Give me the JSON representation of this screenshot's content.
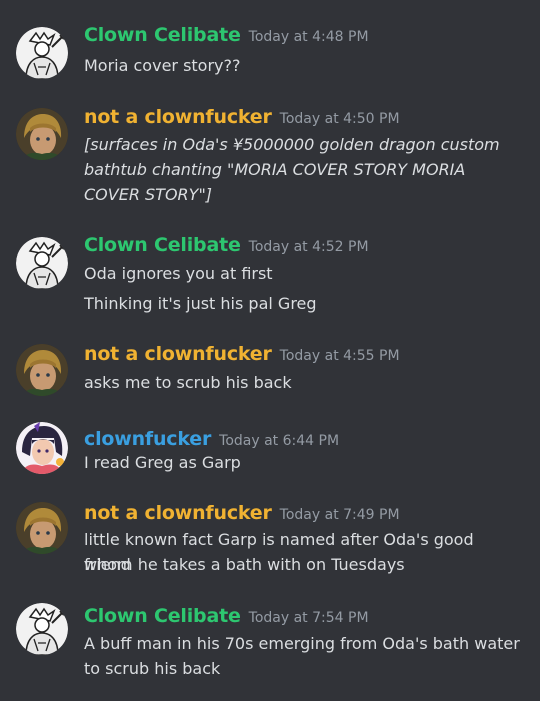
{
  "colors": {
    "background": "#313338",
    "clown_celibate": "#2dc770",
    "not_a_clownfucker": "#f0b232",
    "clownfucker": "#3a9fe0",
    "timestamp": "#949ba4",
    "text": "#dbdee1"
  },
  "messages": [
    {
      "author": "Clown Celibate",
      "timestamp": "Today at 4:48 PM",
      "lines": [
        "Moria cover story??"
      ]
    },
    {
      "author": "not a clownfucker",
      "timestamp": "Today at 4:50 PM",
      "lines": [
        "[surfaces in Oda's ¥5000000 golden dragon custom",
        "bathtub chanting \"MORIA COVER STORY MORIA",
        "COVER STORY\"]"
      ]
    },
    {
      "author": "Clown Celibate",
      "timestamp": "Today at 4:52 PM",
      "lines": [
        "Oda ignores you at first",
        "Thinking it's just his pal Greg"
      ]
    },
    {
      "author": "not a clownfucker",
      "timestamp": "Today at 4:55 PM",
      "lines": [
        "asks me to scrub his back"
      ]
    },
    {
      "author": "clownfucker",
      "timestamp": "Today at 6:44 PM",
      "lines": [
        "I read Greg as Garp"
      ]
    },
    {
      "author": "not a clownfucker",
      "timestamp": "Today at 7:49 PM",
      "lines": [
        "little known fact Garp is named after Oda's good friend",
        "whom he takes a bath with on Tuesdays"
      ]
    },
    {
      "author": "Clown Celibate",
      "timestamp": "Today at 7:54 PM",
      "lines": [
        "A buff man in his 70s emerging from Oda's bath water",
        "to scrub his back"
      ]
    }
  ]
}
